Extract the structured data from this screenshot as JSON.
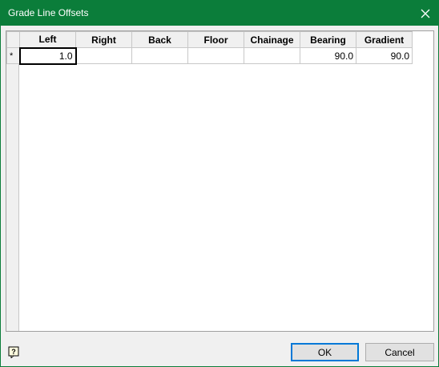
{
  "window": {
    "title": "Grade Line Offsets",
    "titlebar_color": "#0b7d3a"
  },
  "grid": {
    "columns": [
      "Left",
      "Right",
      "Back",
      "Floor",
      "Chainage",
      "Bearing",
      "Gradient"
    ],
    "rows": [
      {
        "marker": "*",
        "cells": [
          "1.0",
          "",
          "",
          "",
          "",
          "90.0",
          "90.0"
        ]
      }
    ]
  },
  "buttons": {
    "ok_label": "OK",
    "cancel_label": "Cancel"
  },
  "icons": {
    "close": "close-icon",
    "help": "help-icon"
  }
}
